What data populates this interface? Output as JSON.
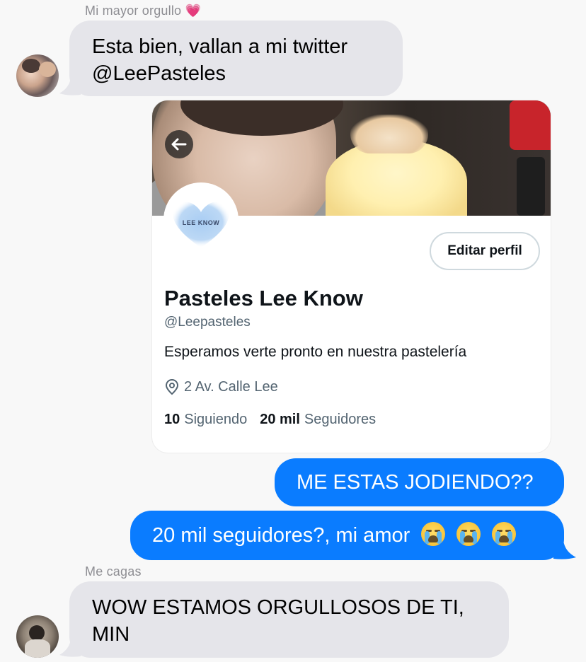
{
  "thread": {
    "first_sender": "Mi mayor orgullo",
    "first_sender_emoji": "💗",
    "messages_in_1": [
      "Esta bien, vallan a mi twitter",
      "@LeePasteles"
    ],
    "second_sender": "Me cagas",
    "messages_in_2": [
      "WOW ESTAMOS ORGULLOSOS DE TI,",
      "MIN"
    ],
    "messages_out": [
      "ME ESTAS JODIENDO??",
      "20 mil seguidores?, mi amor"
    ]
  },
  "profile_card": {
    "logo_text": "LEE KNOW",
    "edit_button": "Editar perfil",
    "name": "Pasteles Lee Know",
    "handle": "@Leepasteles",
    "bio": "Esperamos verte pronto en nuestra pastelería",
    "location": "2 Av. Calle Lee",
    "following_count": "10",
    "following_label": "Siguiendo",
    "followers_count": "20 mil",
    "followers_label": "Seguidores"
  },
  "colors": {
    "incoming_bubble": "#e5e5ea",
    "outgoing_bubble": "#0a7cff",
    "background": "#f8f8f8"
  },
  "icons": [
    "back-arrow-icon",
    "location-pin-icon",
    "crying-emoji-icon"
  ]
}
